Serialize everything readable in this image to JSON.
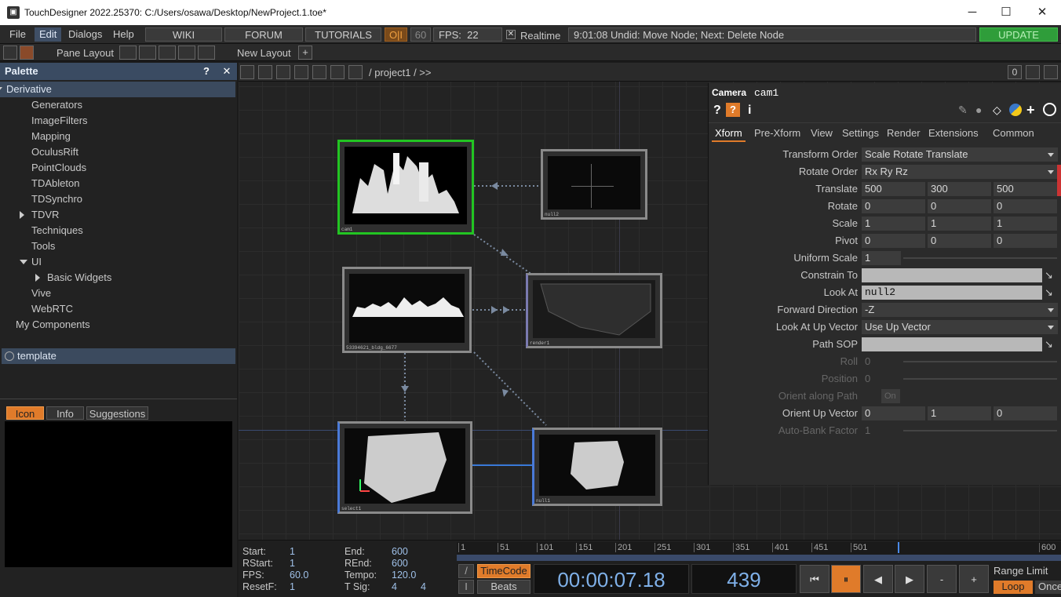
{
  "window": {
    "title": "TouchDesigner 2022.25370: C:/Users/osawa/Desktop/NewProject.1.toe*",
    "min": "─",
    "max": "☐",
    "close": "✕"
  },
  "menu": {
    "file": "File",
    "edit": "Edit",
    "dialogs": "Dialogs",
    "help": "Help",
    "wiki": "WIKI",
    "forum": "FORUM",
    "tutorials": "TUTORIALS",
    "oi": "O|I",
    "fps_cap": "60",
    "fps_label": "FPS:",
    "fps_value": "22",
    "realtime_check": "✕",
    "realtime": "Realtime",
    "status": "9:01:08 Undid: Move Node; Next: Delete Node",
    "update": "UPDATE"
  },
  "toolbar": {
    "pane_layout": "Pane Layout",
    "new_layout": "New Layout",
    "plus": "+"
  },
  "palette": {
    "title": "Palette",
    "help": "?",
    "close": "✕",
    "items": [
      "Derivative",
      "Generators",
      "ImageFilters",
      "Mapping",
      "OculusRift",
      "PointClouds",
      "TDAbleton",
      "TDSynchro",
      "TDVR",
      "Techniques",
      "Tools",
      "UI",
      "Basic Widgets",
      "Vive",
      "WebRTC",
      "My Components"
    ],
    "template": "template",
    "tabs": [
      "Icon",
      "Info",
      "Suggestions"
    ]
  },
  "network": {
    "path": "/ project1 / >>",
    "count": "0",
    "nodes": [
      "cam1",
      "null2",
      "bldg",
      "render",
      "select1",
      "null1"
    ],
    "node_labels": [
      "cam1",
      "null2",
      "53394621_bldg_6677",
      "render1",
      "select1",
      "null1"
    ]
  },
  "params": {
    "type": "Camera",
    "name": "cam1",
    "tabs": [
      "Xform",
      "Pre-Xform",
      "View",
      "Settings",
      "Render",
      "Extensions",
      "Common"
    ],
    "rows": [
      {
        "label": "Transform Order",
        "values": [
          "Scale Rotate Translate"
        ]
      },
      {
        "label": "Rotate Order",
        "values": [
          "Rx Ry Rz"
        ]
      },
      {
        "label": "Translate",
        "values": [
          "500",
          "300",
          "500"
        ]
      },
      {
        "label": "Rotate",
        "values": [
          "0",
          "0",
          "0"
        ]
      },
      {
        "label": "Scale",
        "values": [
          "1",
          "1",
          "1"
        ]
      },
      {
        "label": "Pivot",
        "values": [
          "0",
          "0",
          "0"
        ]
      },
      {
        "label": "Uniform Scale",
        "values": [
          "1"
        ]
      },
      {
        "label": "Constrain To",
        "values": [
          ""
        ]
      },
      {
        "label": "Look At",
        "values": [
          "null2"
        ]
      },
      {
        "label": "Forward Direction",
        "values": [
          "-Z"
        ]
      },
      {
        "label": "Look At Up Vector",
        "values": [
          "Use Up Vector"
        ]
      },
      {
        "label": "Path SOP",
        "values": [
          ""
        ]
      },
      {
        "label": "Roll",
        "values": [
          "0"
        ]
      },
      {
        "label": "Position",
        "values": [
          "0"
        ]
      },
      {
        "label": "Orient along Path",
        "values": [
          "On"
        ]
      },
      {
        "label": "Orient Up Vector",
        "values": [
          "0",
          "1",
          "0"
        ]
      },
      {
        "label": "Auto-Bank Factor",
        "values": [
          "1"
        ]
      }
    ]
  },
  "timeline": {
    "start_l": "Start:",
    "start": "1",
    "end_l": "End:",
    "end": "600",
    "rstart_l": "RStart:",
    "rstart": "1",
    "rend_l": "REnd:",
    "rend": "600",
    "fps_l": "FPS:",
    "fps": "60.0",
    "tempo_l": "Tempo:",
    "tempo": "120.0",
    "resetf_l": "ResetF:",
    "resetf": "1",
    "tsig_l": "T Sig:",
    "tsig1": "4",
    "tsig2": "4",
    "ticks": [
      "1",
      "51",
      "101",
      "151",
      "201",
      "251",
      "301",
      "351",
      "401",
      "451",
      "501",
      "600"
    ],
    "timecode_btn": "TimeCode",
    "beats_btn": "Beats",
    "timecode": "00:00:07.18",
    "frame": "439",
    "range_limit": "Range Limit",
    "loop": "Loop",
    "once": "Once",
    "minus": "-",
    "plus": "+",
    "slash": "/",
    "bar": "I"
  },
  "colors": {
    "accent": "#e07b2a",
    "select_blue": "#3b4a5e",
    "node_green": "#22c422",
    "update_green": "#2f9d3a"
  }
}
